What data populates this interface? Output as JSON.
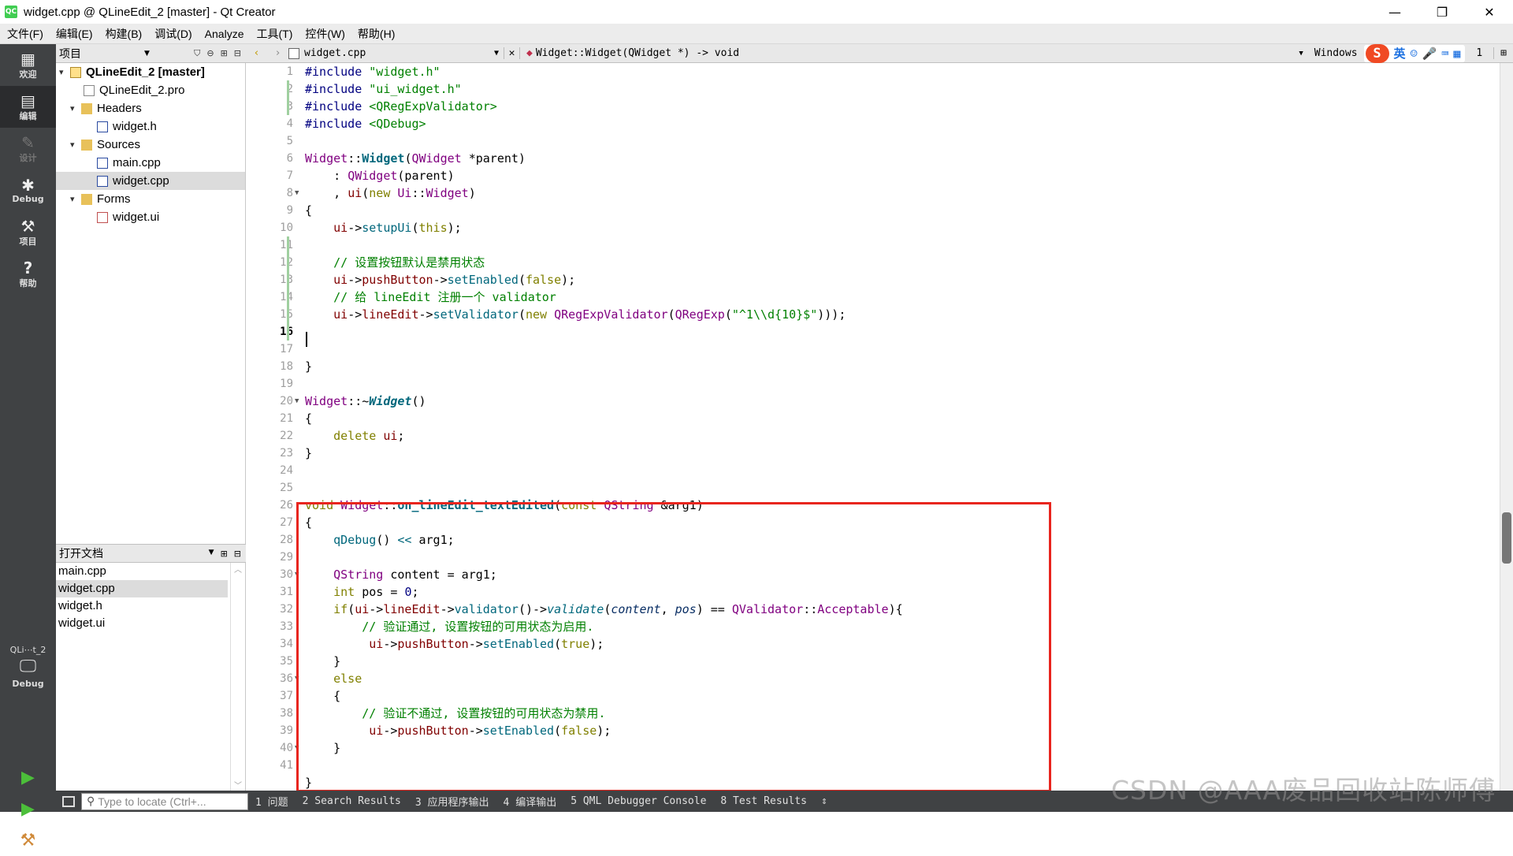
{
  "window": {
    "title": "widget.cpp @ QLineEdit_2 [master] - Qt Creator",
    "logo": "QC",
    "minimize": "—",
    "maximize": "❐",
    "close": "✕"
  },
  "menu": [
    "文件(F)",
    "编辑(E)",
    "构建(B)",
    "调试(D)",
    "Analyze",
    "工具(T)",
    "控件(W)",
    "帮助(H)"
  ],
  "modes": [
    {
      "label": "欢迎",
      "icon": "grid-icon"
    },
    {
      "label": "编辑",
      "icon": "edit-icon"
    },
    {
      "label": "设计",
      "icon": "pencil-icon"
    },
    {
      "label": "Debug",
      "icon": "bug-icon"
    },
    {
      "label": "项目",
      "icon": "wrench-icon"
    },
    {
      "label": "帮助",
      "icon": "help-icon"
    }
  ],
  "kit": {
    "project": "QLi⋯t_2",
    "config": "Debug"
  },
  "projects_pane": {
    "title": "项目",
    "tree": [
      {
        "label": "QLineEdit_2 [master]",
        "indent": 0,
        "arrow": "▾",
        "bold": true
      },
      {
        "label": "QLineEdit_2.pro",
        "indent": 1,
        "arrow": ""
      },
      {
        "label": "Headers",
        "indent": 1,
        "arrow": "▾"
      },
      {
        "label": "widget.h",
        "indent": 2,
        "arrow": ""
      },
      {
        "label": "Sources",
        "indent": 1,
        "arrow": "▾"
      },
      {
        "label": "main.cpp",
        "indent": 2,
        "arrow": ""
      },
      {
        "label": "widget.cpp",
        "indent": 2,
        "arrow": "",
        "selected": true
      },
      {
        "label": "Forms",
        "indent": 1,
        "arrow": "▾"
      },
      {
        "label": "widget.ui",
        "indent": 2,
        "arrow": ""
      }
    ]
  },
  "open_docs": {
    "title": "打开文档",
    "items": [
      {
        "label": "main.cpp"
      },
      {
        "label": "widget.cpp",
        "selected": true
      },
      {
        "label": "widget.h"
      },
      {
        "label": "widget.ui"
      }
    ]
  },
  "editor_header": {
    "file": "widget.cpp",
    "symbol": "Widget::Widget(QWidget *) -> void",
    "encoding": "Windows",
    "line": "1"
  },
  "ime": {
    "logo": "S",
    "lang": "英"
  },
  "editor": {
    "current_line": 16,
    "line_numbers": [
      "1",
      "2",
      "3",
      "4",
      "5",
      "6",
      "7",
      "8",
      "9",
      "10",
      "11",
      "12",
      "13",
      "14",
      "15",
      "16",
      "17",
      "18",
      "19",
      "20",
      "21",
      "22",
      "23",
      "24",
      "25",
      "26",
      "27",
      "28",
      "29",
      "30",
      "31",
      "32",
      "33",
      "34",
      "35",
      "36",
      "37",
      "38",
      "39",
      "40",
      "41"
    ],
    "code": {
      "l1a": "#include ",
      "l1b": "\"widget.h\"",
      "l2a": "#include ",
      "l2b": "\"ui_widget.h\"",
      "l3a": "#include ",
      "l3b": "<QRegExpValidator>",
      "l4a": "#include ",
      "l4b": "<QDebug>",
      "l6a": "Widget",
      "l6b": "::",
      "l6c": "Widget",
      "l6d": "(",
      "l6e": "QWidget",
      "l6f": " *parent)",
      "l7a": "    : ",
      "l7b": "QWidget",
      "l7c": "(parent)",
      "l8a": "    , ",
      "l8b": "ui",
      "l8c": "(",
      "l8d": "new",
      "l8e": " ",
      "l8f": "Ui",
      "l8g": "::",
      "l8h": "Widget",
      "l8i": ")",
      "l9": "{",
      "l10a": "    ",
      "l10b": "ui",
      "l10c": "->",
      "l10d": "setupUi",
      "l10e": "(",
      "l10f": "this",
      "l10g": ");",
      "l12": "    // 设置按钮默认是禁用状态",
      "l13a": "    ",
      "l13b": "ui",
      "l13c": "->",
      "l13d": "pushButton",
      "l13e": "->",
      "l13f": "setEnabled",
      "l13g": "(",
      "l13h": "false",
      "l13i": ");",
      "l14": "    // 给 lineEdit 注册一个 validator",
      "l15a": "    ",
      "l15b": "ui",
      "l15c": "->",
      "l15d": "lineEdit",
      "l15e": "->",
      "l15f": "setValidator",
      "l15g": "(",
      "l15h": "new",
      "l15i": " ",
      "l15j": "QRegExpValidator",
      "l15k": "(",
      "l15l": "QRegExp",
      "l15m": "(",
      "l15n": "\"^1\\\\d{10}$\"",
      "l15o": ")));",
      "l18": "}",
      "l20a": "Widget",
      "l20b": "::~",
      "l20c": "Widget",
      "l20d": "()",
      "l21": "{",
      "l22a": "    ",
      "l22b": "delete",
      "l22c": " ",
      "l22d": "ui",
      "l22e": ";",
      "l23": "}",
      "l26a": "void",
      "l26b": " ",
      "l26c": "Widget",
      "l26d": "::",
      "l26e": "on_lineEdit_textEdited",
      "l26f": "(",
      "l26g": "const",
      "l26h": " ",
      "l26i": "QString",
      "l26j": " &arg1)",
      "l27": "{",
      "l28a": "    ",
      "l28b": "qDebug",
      "l28c": "() ",
      "l28d": "<<",
      "l28e": " arg1;",
      "l30a": "    ",
      "l30b": "QString",
      "l30c": " content = arg1;",
      "l31a": "    ",
      "l31b": "int",
      "l31c": " pos = ",
      "l31d": "0",
      "l31e": ";",
      "l32a": "    ",
      "l32b": "if",
      "l32c": "(",
      "l32d": "ui",
      "l32e": "->",
      "l32f": "lineEdit",
      "l32g": "->",
      "l32h": "validator",
      "l32i": "()->",
      "l32j": "validate",
      "l32k": "(",
      "l32l": "content",
      "l32m": ", ",
      "l32n": "pos",
      "l32o": ") == ",
      "l32p": "QValidator",
      "l32q": "::",
      "l32r": "Acceptable",
      "l32s": "){",
      "l33": "        // 验证通过, 设置按钮的可用状态为启用.",
      "l34a": "         ",
      "l34b": "ui",
      "l34c": "->",
      "l34d": "pushButton",
      "l34e": "->",
      "l34f": "setEnabled",
      "l34g": "(",
      "l34h": "true",
      "l34i": ");",
      "l35": "    }",
      "l36": "    else",
      "l37": "    {",
      "l38": "        // 验证不通过, 设置按钮的可用状态为禁用.",
      "l39a": "         ",
      "l39b": "ui",
      "l39c": "->",
      "l39d": "pushButton",
      "l39e": "->",
      "l39f": "setEnabled",
      "l39g": "(",
      "l39h": "false",
      "l39i": ");",
      "l40": "    }",
      "l42": "}"
    }
  },
  "statusbar": {
    "locator_placeholder": "Type to locate (Ctrl+...",
    "panes": [
      "1 问题",
      "2 Search Results",
      "3 应用程序输出",
      "4 编译输出",
      "5 QML Debugger Console",
      "8 Test Results"
    ],
    "more": "⇕"
  },
  "watermark": "CSDN @AAA废品回收站陈师傅"
}
